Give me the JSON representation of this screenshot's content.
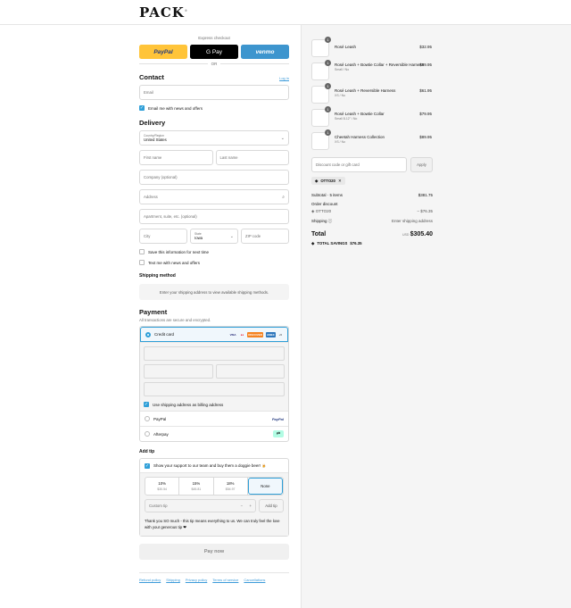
{
  "brand": {
    "logo": "PACK",
    "logo_mark": "®"
  },
  "express": {
    "label": "Express checkout",
    "paypal": "PayPal",
    "gpay": "G Pay",
    "venmo": "venmo",
    "or": "OR"
  },
  "contact": {
    "title": "Contact",
    "login": "Log in",
    "email_placeholder": "Email",
    "news_opt": "Email me with news and offers"
  },
  "delivery": {
    "title": "Delivery",
    "country_label": "Country/Region",
    "country_value": "United States",
    "first_name": "First name",
    "last_name": "Last name",
    "company": "Company (optional)",
    "address": "Address",
    "apartment": "Apartment, suite, etc. (optional)",
    "city": "City",
    "state_label": "State",
    "state_value": "Iowa",
    "zip": "ZIP code",
    "save_info": "Save this information for next time",
    "text_me": "Text me with news and offers"
  },
  "shipping": {
    "title": "Shipping method",
    "notice": "Enter your shipping address to view available shipping methods."
  },
  "payment": {
    "title": "Payment",
    "subtitle": "All transactions are secure and encrypted.",
    "credit_card": "Credit card",
    "card_brands": [
      "VISA",
      "MC",
      "DISCOVER",
      "AMEX",
      "+5"
    ],
    "billing_same": "Use shipping address as billing address",
    "paypal": "PayPal",
    "paypal_logo": "PayPal",
    "afterpay": "Afterpay"
  },
  "tip": {
    "title": "Add tip",
    "support": "Show your support to our team and buy them a doggie beer! 🍺",
    "options": [
      {
        "pct": "10%",
        "amt": "$30.54"
      },
      {
        "pct": "15%",
        "amt": "$45.81"
      },
      {
        "pct": "18%",
        "amt": "$54.97"
      },
      {
        "pct": "None",
        "amt": ""
      }
    ],
    "custom_placeholder": "Custom tip",
    "add_button": "Add tip",
    "thanks": "Thank you SO much - this tip means everything to us. We can truly feel the love with your generous tip ❤"
  },
  "pay_now": "Pay now",
  "footer": [
    "Refund policy",
    "Shipping",
    "Privacy policy",
    "Terms of service",
    "Cancellations"
  ],
  "cart": {
    "items": [
      {
        "name": "Rosé Leash",
        "variant": "",
        "qty": "1",
        "price": "$32.95"
      },
      {
        "name": "Rosé Leash + Bowtie Collar + Reversible Harness",
        "variant": "Small / No",
        "qty": "1",
        "price": "$99.95"
      },
      {
        "name": "Rosé Leash + Reversible Harness",
        "variant": "XS / No",
        "qty": "1",
        "price": "$61.95"
      },
      {
        "name": "Rosé Leash + Bowtie Collar",
        "variant": "Small 8-12\" / No",
        "qty": "1",
        "price": "$79.95"
      },
      {
        "name": "Cheetah Harness Collection",
        "variant": "XS / No",
        "qty": "1",
        "price": "$89.95"
      }
    ],
    "discount_placeholder": "Discount code or gift card",
    "apply": "Apply",
    "code": "OTTO20",
    "subtotal_label": "Subtotal · 5 items",
    "subtotal": "$381.75",
    "order_discount_label": "Order discount",
    "discount_code": "OTTO20",
    "discount_amount": "– $76.35",
    "shipping_label": "Shipping",
    "shipping_value": "Enter shipping address",
    "total_label": "Total",
    "currency": "USD",
    "total": "$305.40",
    "savings_label": "TOTAL SAVINGS",
    "savings": "$76.35"
  }
}
